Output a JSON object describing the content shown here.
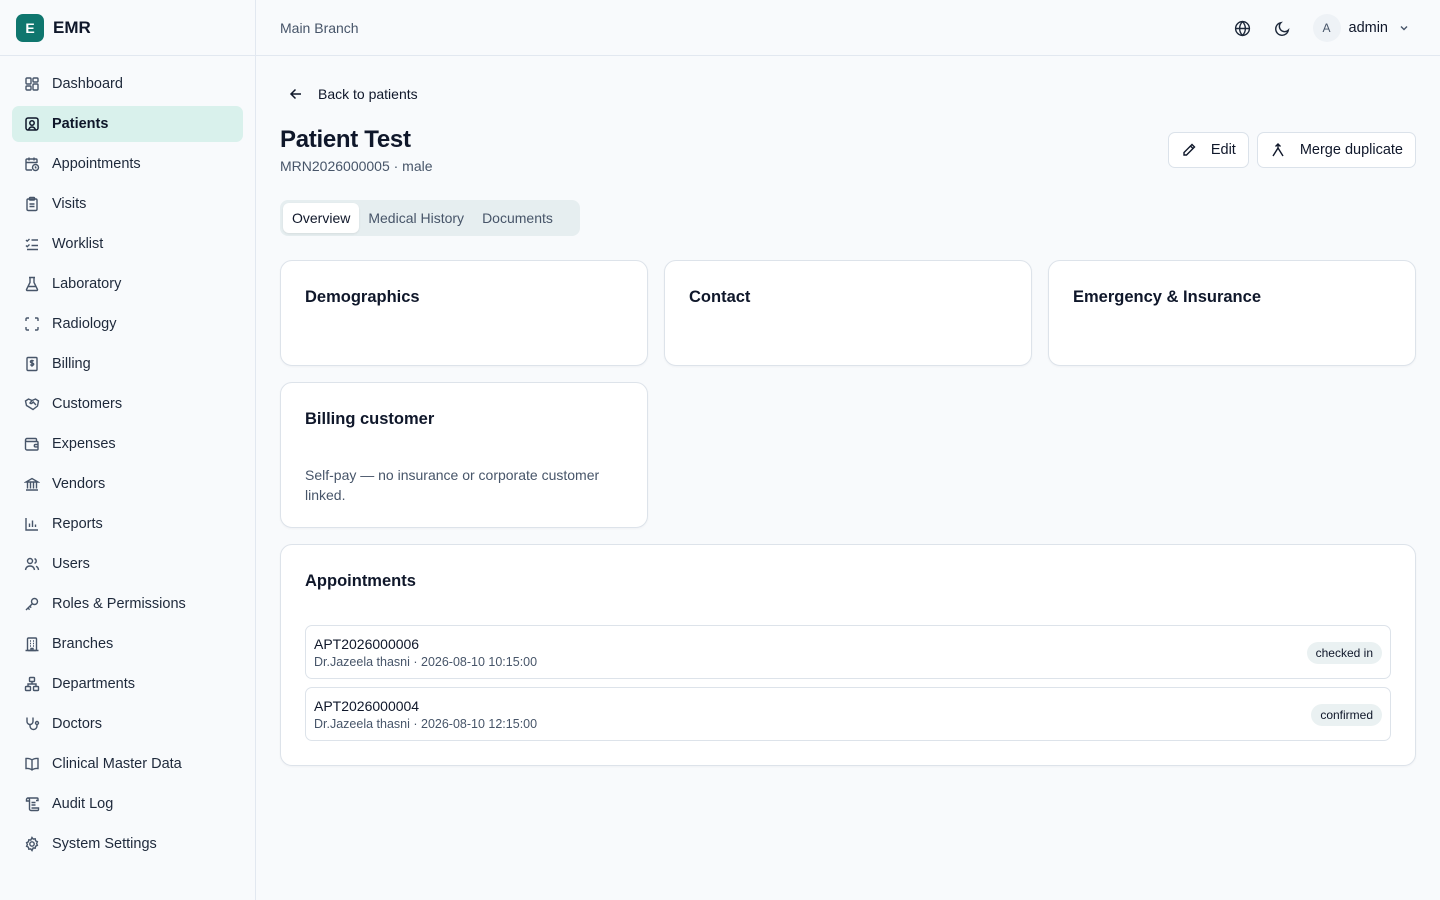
{
  "app": {
    "logo_letter": "E",
    "name": "EMR"
  },
  "header": {
    "branch": "Main Branch",
    "user_initial": "A",
    "user_name": "admin"
  },
  "sidebar": {
    "items": [
      {
        "label": "Dashboard",
        "icon": "dashboard-icon"
      },
      {
        "label": "Patients",
        "icon": "patients-icon",
        "active": true
      },
      {
        "label": "Appointments",
        "icon": "calendar-clock-icon"
      },
      {
        "label": "Visits",
        "icon": "clipboard-icon"
      },
      {
        "label": "Worklist",
        "icon": "checklist-icon"
      },
      {
        "label": "Laboratory",
        "icon": "flask-icon"
      },
      {
        "label": "Radiology",
        "icon": "scan-icon"
      },
      {
        "label": "Billing",
        "icon": "receipt-icon"
      },
      {
        "label": "Customers",
        "icon": "handshake-icon"
      },
      {
        "label": "Expenses",
        "icon": "wallet-icon"
      },
      {
        "label": "Vendors",
        "icon": "bank-icon"
      },
      {
        "label": "Reports",
        "icon": "bar-chart-icon"
      },
      {
        "label": "Users",
        "icon": "users-icon"
      },
      {
        "label": "Roles & Permissions",
        "icon": "key-icon"
      },
      {
        "label": "Branches",
        "icon": "building-icon"
      },
      {
        "label": "Departments",
        "icon": "network-icon"
      },
      {
        "label": "Doctors",
        "icon": "stethoscope-icon"
      },
      {
        "label": "Clinical Master Data",
        "icon": "book-icon"
      },
      {
        "label": "Audit Log",
        "icon": "scroll-icon"
      },
      {
        "label": "System Settings",
        "icon": "gear-icon"
      }
    ]
  },
  "page": {
    "back_label": "Back to patients",
    "title": "Patient Test",
    "subtitle": "MRN2026000005 · male",
    "edit_label": "Edit",
    "merge_label": "Merge duplicate",
    "tabs": [
      {
        "label": "Overview",
        "active": true
      },
      {
        "label": "Medical History"
      },
      {
        "label": "Documents"
      }
    ]
  },
  "cards": {
    "demographics": "Demographics",
    "contact": "Contact",
    "emergency": "Emergency & Insurance",
    "billing_title": "Billing customer",
    "billing_text": "Self-pay — no insurance or corporate customer linked."
  },
  "appointments": {
    "title": "Appointments",
    "rows": [
      {
        "id": "APT2026000006",
        "meta": "Dr.Jazeela thasni · 2026-08-10 10:15:00",
        "status": "checked in"
      },
      {
        "id": "APT2026000004",
        "meta": "Dr.Jazeela thasni · 2026-08-10 12:15:00",
        "status": "confirmed"
      }
    ]
  },
  "colors": {
    "accent": "#0f766e",
    "active_nav_bg": "#d9f1ec",
    "page_bg": "#f8fafc"
  }
}
